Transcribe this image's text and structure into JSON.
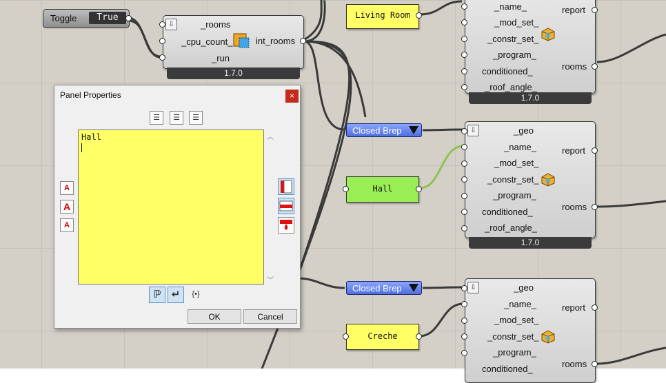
{
  "toggle": {
    "label": "Toggle",
    "value": "True"
  },
  "solver": {
    "inputs": [
      "_rooms",
      "_cpu_count_",
      "_run"
    ],
    "output": "int_rooms",
    "version": "1.7.0"
  },
  "panels": {
    "top": "Living Room",
    "mid": "Hall",
    "bottom": "Creche"
  },
  "closed_brep": {
    "label": "Closed Brep"
  },
  "room_nodes": {
    "inputs": [
      "_geo",
      "_name_",
      "_mod_set_",
      "_constr_set_",
      "_program_",
      "conditioned_",
      "_roof_angle_"
    ],
    "outputs": [
      "report",
      "rooms"
    ],
    "version": "1.7.0"
  },
  "dialog": {
    "title": "Panel Properties",
    "close": "×",
    "text": "Hall",
    "ok": "OK",
    "cancel": "Cancel",
    "align_icons": [
      "align-left-icon",
      "align-center-icon",
      "align-right-icon"
    ],
    "font_icons": [
      "font-increase-icon",
      "font-style-icon",
      "font-decrease-icon"
    ],
    "color_icons": [
      "wire-left-icon",
      "wire-right-icon",
      "fill-color-icon"
    ],
    "bottom_icons": [
      "paragraph-icon",
      "wrap-icon",
      "data-icon"
    ],
    "bottom_glyphs": [
      "ℙ",
      "↵",
      "{•}"
    ]
  },
  "colors": {
    "panel_yellow": "#ffff66",
    "panel_green": "#99ee55",
    "brep_blue": "#6b86ef",
    "close_red": "#c42b1c"
  }
}
